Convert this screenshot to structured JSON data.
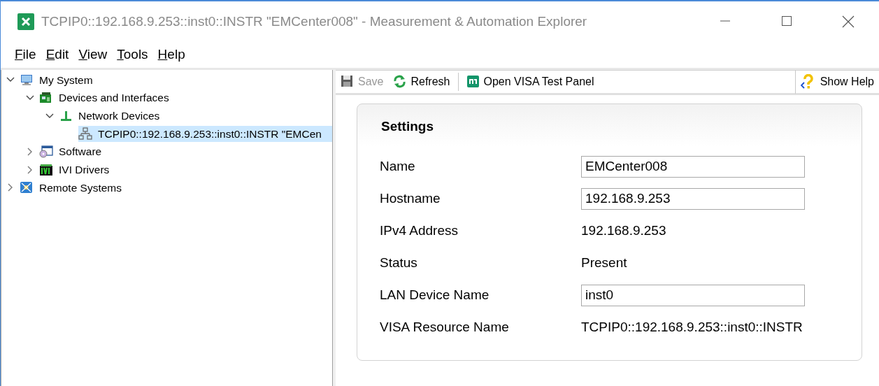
{
  "window": {
    "title": "TCPIP0::192.168.9.253::inst0::INSTR \"EMCenter008\" - Measurement & Automation Explorer",
    "active": false
  },
  "menu": [
    "File",
    "Edit",
    "View",
    "Tools",
    "Help"
  ],
  "tree": [
    {
      "label": "My System",
      "kind": "computer",
      "expanded": true,
      "selected": false,
      "children": [
        {
          "label": "Devices and Interfaces",
          "kind": "board",
          "expanded": true,
          "selected": false,
          "children": [
            {
              "label": "Network Devices",
              "kind": "network",
              "expanded": true,
              "selected": false,
              "children": [
                {
                  "label": "TCPIP0::192.168.9.253::inst0::INSTR \"EMCen",
                  "kind": "lan",
                  "selected": true
                }
              ]
            }
          ]
        },
        {
          "label": "Software",
          "kind": "software",
          "expanded": false,
          "selected": false
        },
        {
          "label": "IVI Drivers",
          "kind": "ivi",
          "expanded": false,
          "selected": false
        }
      ]
    },
    {
      "label": "Remote Systems",
      "kind": "remote",
      "expanded": false,
      "selected": false
    }
  ],
  "toolbar": [
    {
      "label": "Save",
      "kind": "save",
      "disabled": true
    },
    {
      "label": "Refresh",
      "kind": "refresh",
      "disabled": false
    },
    {
      "label": "Open VISA Test Panel",
      "kind": "ni",
      "disabled": false
    }
  ],
  "help_button": {
    "label": "Show Help"
  },
  "settings": {
    "title": "Settings",
    "fields": [
      {
        "kind": "input",
        "label": "Name",
        "value": "EMCenter008"
      },
      {
        "kind": "input",
        "label": "Hostname",
        "value": "192.168.9.253"
      },
      {
        "kind": "text",
        "label": "IPv4 Address",
        "value": "192.168.9.253"
      },
      {
        "kind": "text",
        "label": "Status",
        "value": "Present"
      },
      {
        "kind": "input",
        "label": "LAN Device Name",
        "value": "inst0"
      },
      {
        "kind": "text",
        "label": "VISA Resource Name",
        "value": "TCPIP0::192.168.9.253::inst0::INSTR"
      }
    ]
  }
}
